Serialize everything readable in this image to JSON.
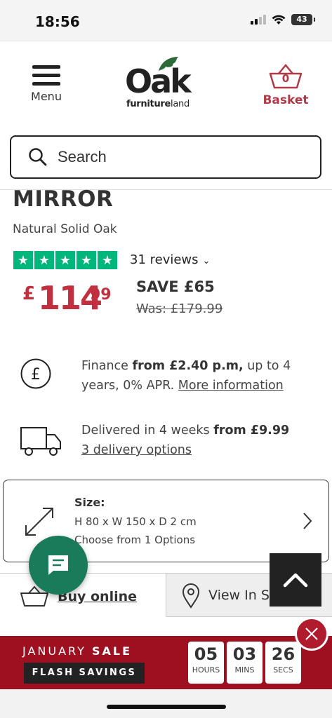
{
  "status_bar": {
    "time": "18:56",
    "battery": "43"
  },
  "header": {
    "menu_label": "Menu",
    "logo": {
      "word": "Oak",
      "sub_bold": "furniture",
      "sub_rest": "land"
    },
    "basket_count": "0",
    "basket_label": "Basket"
  },
  "search": {
    "placeholder": "Search"
  },
  "product": {
    "title": "MIRROR",
    "subtitle": "Natural Solid Oak",
    "rating_stars": 5,
    "reviews": "31 reviews",
    "price_currency": "£",
    "price_main": "114",
    "price_cents": "99",
    "save": "SAVE £65",
    "was": "Was: £179.99"
  },
  "finance": {
    "text1": "Finance ",
    "bold": "from £2.40 p.m,",
    "text2": " up to 4 years, 0% APR. ",
    "link": "More information"
  },
  "delivery": {
    "text1": "Delivered in 4 weeks ",
    "bold": "from £9.99",
    "link": "3 delivery options"
  },
  "size": {
    "label": "Size:",
    "dims": "H 80 x W 150 x D 2 cm",
    "options": "Choose from 1 Options"
  },
  "buy_tabs": {
    "online": "Buy online",
    "store": "View In Store"
  },
  "sale": {
    "title_1": "JANUARY",
    "title_2": "SALE",
    "flash": "FLASH SAVINGS",
    "countdown": [
      {
        "value": "05",
        "unit": "HOURS"
      },
      {
        "value": "03",
        "unit": "MINS"
      },
      {
        "value": "26",
        "unit": "SECS"
      }
    ]
  },
  "colors": {
    "accent": "#b03a48",
    "price": "#c0303e",
    "trustpilot": "#00b67a",
    "chat": "#1a7b5a",
    "banner": "#9e1020"
  }
}
